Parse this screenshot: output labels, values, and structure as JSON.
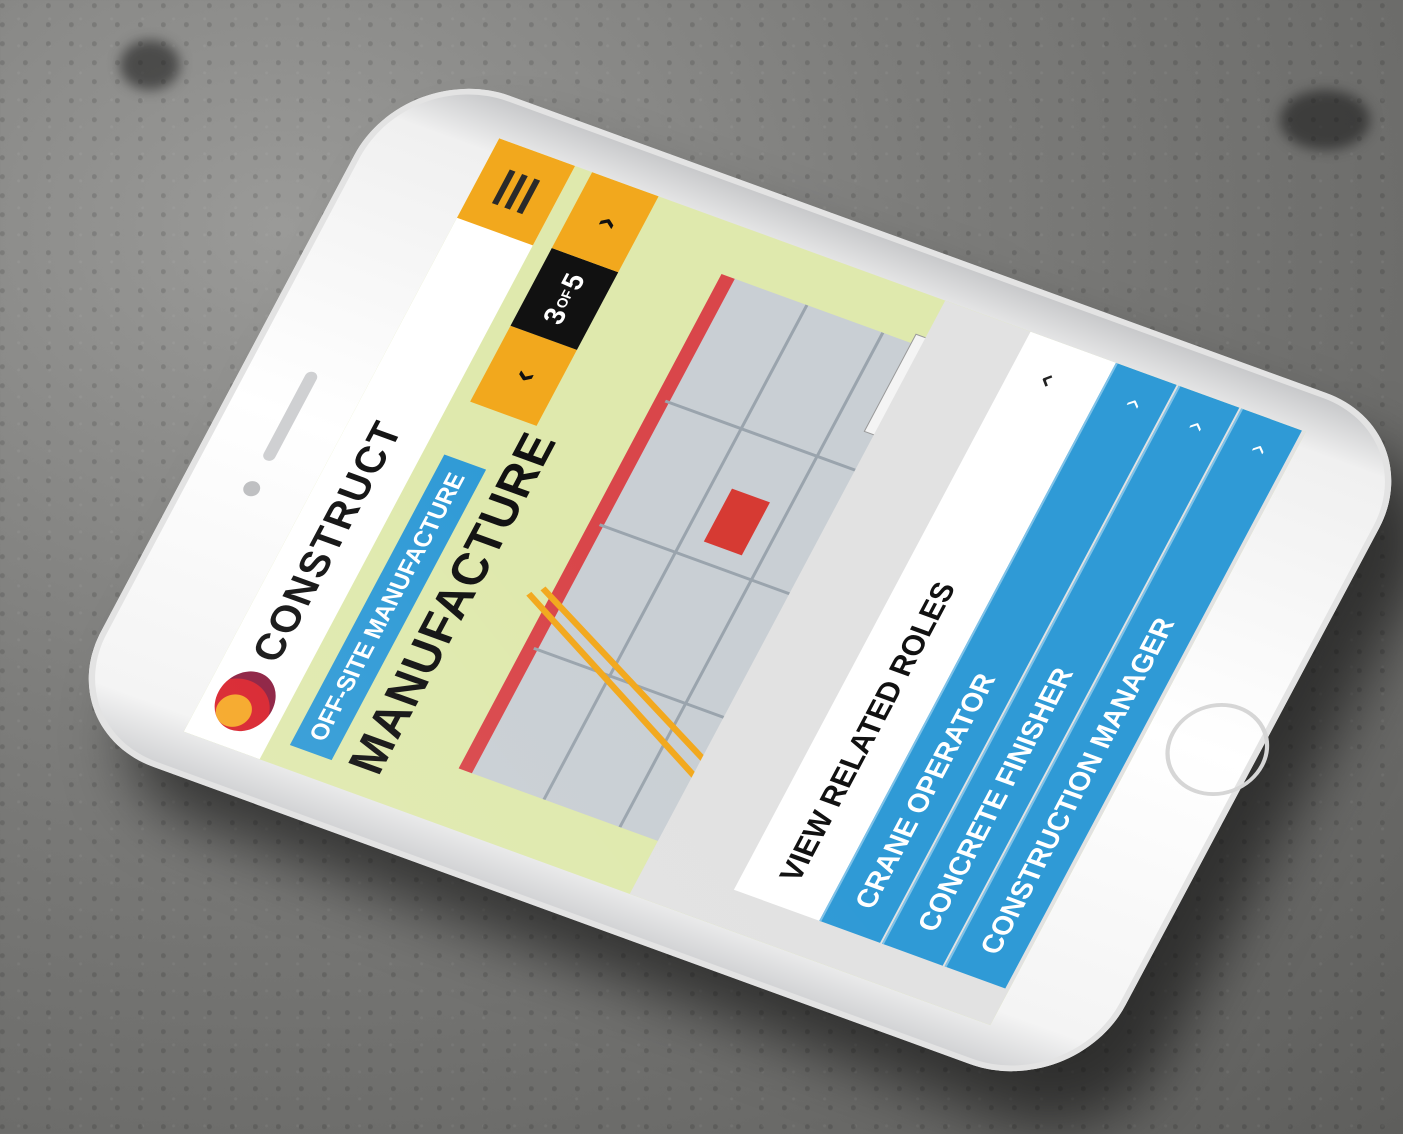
{
  "brand": {
    "name": "CONSTRUCT"
  },
  "nav": {
    "menu_icon": "hamburger-icon",
    "pager": {
      "prev_icon": "chevron-left-icon",
      "page": "3",
      "of": "OF",
      "total": "5",
      "next_icon": "chevron-right-icon"
    }
  },
  "hero": {
    "tag": "OFF-SITE MANUFACTURE",
    "title": "MANUFACTURE"
  },
  "roles": {
    "header": "VIEW RELATED ROLES",
    "header_icon": "chevron-up-icon",
    "items": [
      {
        "label": "CRANE OPERATOR",
        "icon": "chevron-right-icon"
      },
      {
        "label": "CONCRETE FINISHER",
        "icon": "chevron-right-icon"
      },
      {
        "label": "CONSTRUCTION MANAGER",
        "icon": "chevron-right-icon"
      }
    ]
  },
  "colors": {
    "accent": "#f2a81d",
    "blue": "#2f9ad6",
    "hero_bg": "#dfe9ad",
    "dark": "#111111"
  }
}
